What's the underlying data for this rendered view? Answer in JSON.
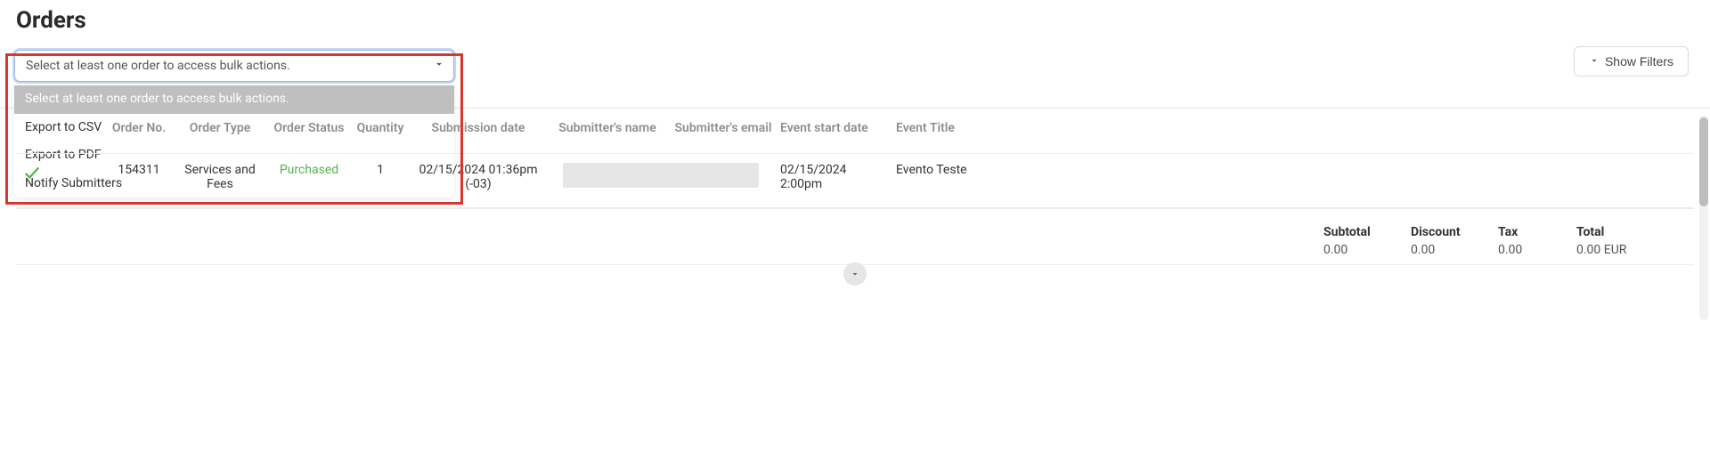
{
  "page": {
    "title": "Orders"
  },
  "toolbar": {
    "bulk_placeholder": "Select at least one order to access bulk actions.",
    "options": [
      "Select at least one order to access bulk actions.",
      "Export to CSV",
      "Export to PDF",
      "Notify Submitters"
    ],
    "show_filters_label": "Show Filters"
  },
  "table": {
    "headers": {
      "order_no": "Order No.",
      "order_type": "Order Type",
      "order_status": "Order Status",
      "quantity": "Quantity",
      "submission_date": "Submission date",
      "submitter_name": "Submitter's name",
      "submitter_email": "Submitter's email",
      "event_start_date": "Event start date",
      "event_title": "Event Title"
    },
    "rows": [
      {
        "checked": true,
        "order_no": "154311",
        "order_type": "Services and Fees",
        "order_status": "Purchased",
        "quantity": "1",
        "submission_date_line1": "02/15/2024 01:36pm",
        "submission_date_line2": "(-03)",
        "submitter_name": "",
        "submitter_email": "",
        "event_start_date": "02/15/2024 2:00pm",
        "event_title": "Evento Teste"
      }
    ]
  },
  "totals": {
    "subtotal_label": "Subtotal",
    "subtotal_value": "0.00",
    "discount_label": "Discount",
    "discount_value": "0.00",
    "tax_label": "Tax",
    "tax_value": "0.00",
    "total_label": "Total",
    "total_value": "0.00 EUR"
  }
}
